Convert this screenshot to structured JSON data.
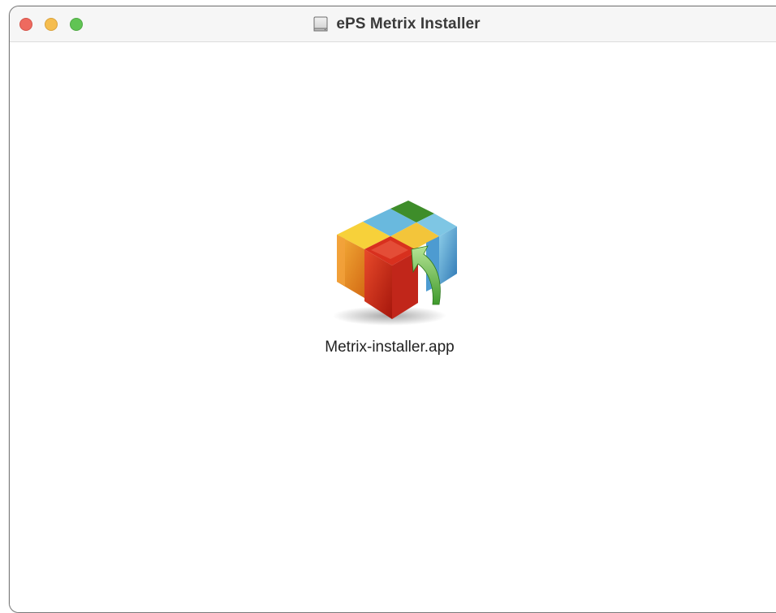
{
  "window": {
    "title": "ePS Metrix Installer",
    "title_icon": "disk-image-icon"
  },
  "traffic_lights": {
    "close_color": "#ee6a5f",
    "minimize_color": "#f5bd4f",
    "zoom_color": "#61c454"
  },
  "items": [
    {
      "label": "Metrix-installer.app",
      "icon": "installer-package-icon"
    }
  ]
}
